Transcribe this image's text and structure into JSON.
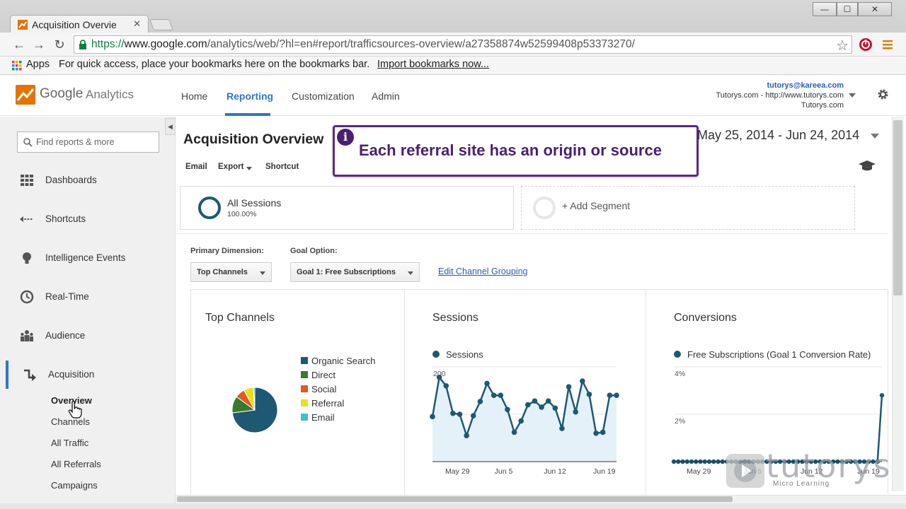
{
  "browser": {
    "tab_title": "Acquisition Overvie",
    "url_scheme": "https://",
    "url_host": "www.google.com",
    "url_path": "/analytics/web/?hl=en#report/trafficsources-overview/a27358874w52599408p53373270/",
    "bookmarks_apps": "Apps",
    "bookmarks_hint": "For quick access, place your bookmarks here on the bookmarks bar.",
    "bookmarks_import": "Import bookmarks now..."
  },
  "header": {
    "brand_google": "Google",
    "brand_analytics": "Analytics",
    "nav": [
      {
        "label": "Home"
      },
      {
        "label": "Reporting"
      },
      {
        "label": "Customization"
      },
      {
        "label": "Admin"
      }
    ],
    "account_email": "tutorys@kareea.com",
    "account_property": "Tutorys.com - http://www.tutorys.com",
    "account_view": "Tutorys.com"
  },
  "sidebar": {
    "search_placeholder": "Find reports & more",
    "items": [
      {
        "label": "Dashboards"
      },
      {
        "label": "Shortcuts"
      },
      {
        "label": "Intelligence Events"
      },
      {
        "label": "Real-Time"
      },
      {
        "label": "Audience"
      },
      {
        "label": "Acquisition"
      }
    ],
    "sub_items": [
      {
        "label": "Overview"
      },
      {
        "label": "Channels"
      },
      {
        "label": "All Traffic"
      },
      {
        "label": "All Referrals"
      },
      {
        "label": "Campaigns"
      }
    ]
  },
  "main": {
    "title": "Acquisition Overview",
    "actions": {
      "email": "Email",
      "export": "Export",
      "shortcut": "Shortcut"
    },
    "date_range": "May 25, 2014 - Jun 24, 2014",
    "segment_all_name": "All Sessions",
    "segment_all_pct": "100.00%",
    "segment_add": "+ Add Segment",
    "primary_dimension_label": "Primary Dimension:",
    "primary_dimension_value": "Top Channels",
    "goal_option_label": "Goal Option:",
    "goal_option_value": "Goal 1: Free Subscriptions",
    "edit_channel_grouping": "Edit Channel Grouping"
  },
  "callout": {
    "message": "Each referral site has an origin or source"
  },
  "colors": {
    "accent": "#2f75d0",
    "callout_border": "#5b2a86",
    "series": "#1f5873"
  },
  "watermark": {
    "brand": "tutorys",
    "tagline": "Micro Learning"
  },
  "chart_data": [
    {
      "type": "pie",
      "title": "Top Channels",
      "categories": [
        "Organic Search",
        "Direct",
        "Social",
        "Referral",
        "Email"
      ],
      "values": [
        73,
        12,
        7,
        7,
        1
      ],
      "colors": [
        "#1f5873",
        "#3a7a2f",
        "#e05a22",
        "#e6e21a",
        "#3fbfd6"
      ],
      "legend": "right"
    },
    {
      "type": "area",
      "title": "Sessions",
      "series": [
        {
          "name": "Sessions",
          "values": [
            95,
            178,
            160,
            102,
            100,
            55,
            97,
            127,
            165,
            140,
            140,
            110,
            62,
            86,
            120,
            128,
            115,
            128,
            113,
            70,
            158,
            105,
            170,
            142,
            60,
            62,
            140,
            140
          ]
        }
      ],
      "ylim": [
        0,
        200
      ],
      "y_ticks": [
        "200",
        "100"
      ],
      "x_ticks": [
        "May 29",
        "Jun 5",
        "Jun 12",
        "Jun 19"
      ],
      "grid": true
    },
    {
      "type": "line",
      "title": "Conversions",
      "series": [
        {
          "name": "Free Subscriptions (Goal 1 Conversion Rate)",
          "values": [
            0,
            0,
            0,
            0,
            0,
            0,
            0,
            0,
            0,
            0,
            0,
            0,
            0,
            0,
            0,
            0,
            0,
            0,
            0,
            0,
            0,
            0,
            0,
            0,
            0,
            0,
            0,
            0,
            0,
            0,
            0,
            0,
            0,
            0,
            0,
            0,
            0,
            0,
            0,
            0,
            0,
            0,
            0,
            0,
            0,
            0,
            0,
            2.8
          ]
        }
      ],
      "ylim": [
        0,
        4
      ],
      "y_ticks": [
        "4%",
        "2%"
      ],
      "x_ticks": [
        "May 29",
        "Jun 5",
        "Jun 12",
        "Jun 19"
      ],
      "grid": true
    }
  ]
}
